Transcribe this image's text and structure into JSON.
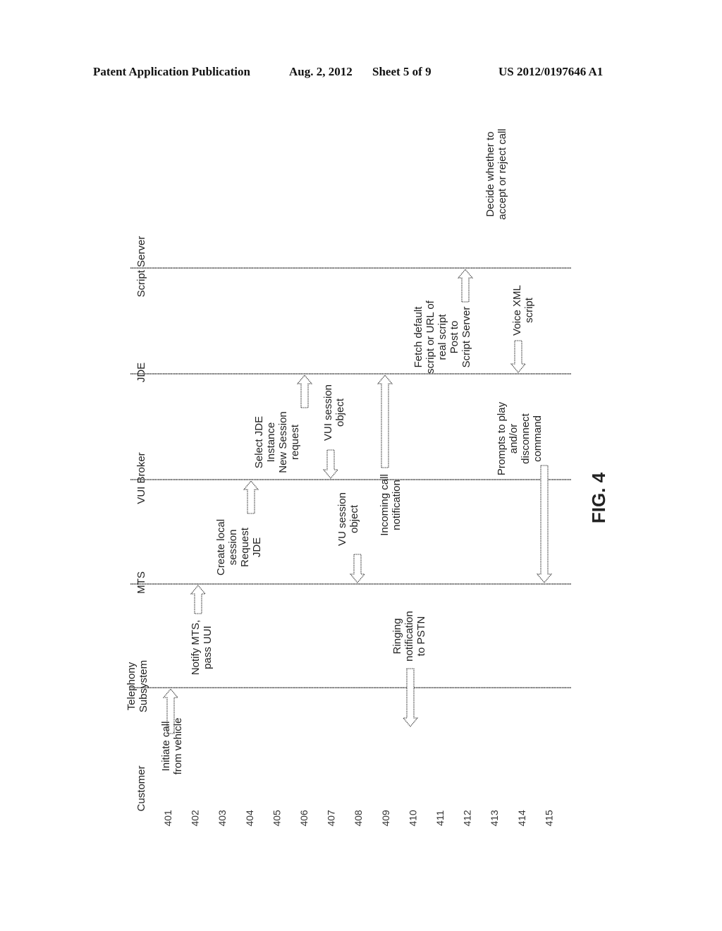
{
  "header": {
    "publication_type": "Patent Application Publication",
    "date": "Aug. 2, 2012",
    "sheet": "Sheet 5 of 9",
    "publication_number": "US 2012/0197646 A1"
  },
  "figure": {
    "label": "FIG. 4",
    "orientation": "rotated 90 degrees counter-clockwise",
    "actors": [
      {
        "id": "customer",
        "lines": [
          "Customer"
        ]
      },
      {
        "id": "telephony",
        "lines": [
          "Telephony",
          "Subsystem"
        ]
      },
      {
        "id": "mts",
        "lines": [
          "MTS"
        ]
      },
      {
        "id": "vui-broker",
        "lines": [
          "VUI Broker"
        ]
      },
      {
        "id": "jde",
        "lines": [
          "JDE"
        ]
      },
      {
        "id": "script-server",
        "lines": [
          "Script Server"
        ]
      }
    ],
    "steps": [
      "401",
      "402",
      "403",
      "404",
      "405",
      "406",
      "407",
      "408",
      "409",
      "410",
      "411",
      "412",
      "413",
      "414",
      "415"
    ],
    "messages": [
      {
        "step": "401",
        "from": "customer",
        "to": "telephony",
        "lines": [
          "Initiate call",
          "from vehicle"
        ]
      },
      {
        "step": "402",
        "from": "telephony",
        "to": "mts",
        "lines": [
          "Notify MTS,",
          "pass UUI"
        ]
      },
      {
        "step": "403",
        "from": "mts",
        "to": "vui-broker",
        "lines": [
          "Create local",
          "session",
          "Request",
          "JDE"
        ]
      },
      {
        "step": "404",
        "from": "vui-broker",
        "to": "jde",
        "lines": [
          "Select JDE",
          "Instance",
          "New Session",
          "request"
        ]
      },
      {
        "step": "407",
        "from": "jde",
        "to": "vui-broker",
        "lines": [
          "VUI session",
          "object"
        ]
      },
      {
        "step": "408",
        "from": "vui-broker",
        "to": "mts",
        "lines": [
          "VU session",
          "object"
        ]
      },
      {
        "step": "409",
        "from": "mts",
        "to": "jde",
        "lines": [
          "Incoming call",
          "notification"
        ]
      },
      {
        "step": "410",
        "from": "telephony",
        "to": "customer",
        "lines": [
          "Ringing",
          "notification",
          "to PSTN"
        ]
      },
      {
        "step": "411",
        "from": "jde",
        "to": "script-server",
        "lines": [
          "Fetch default",
          "script or URL of",
          "real script",
          "Post to",
          "Script Server"
        ]
      },
      {
        "step": "412",
        "from": "script-server",
        "to": "script-server",
        "lines": [
          "Decide whether to",
          "accept or reject call"
        ]
      },
      {
        "step": "414",
        "from": "script-server",
        "to": "jde",
        "lines": [
          "Voice XML",
          "script"
        ]
      },
      {
        "step": "415",
        "from": "jde",
        "to": "mts",
        "lines": [
          "Prompts to play",
          "and/or",
          "disconnect",
          "command"
        ]
      }
    ]
  }
}
